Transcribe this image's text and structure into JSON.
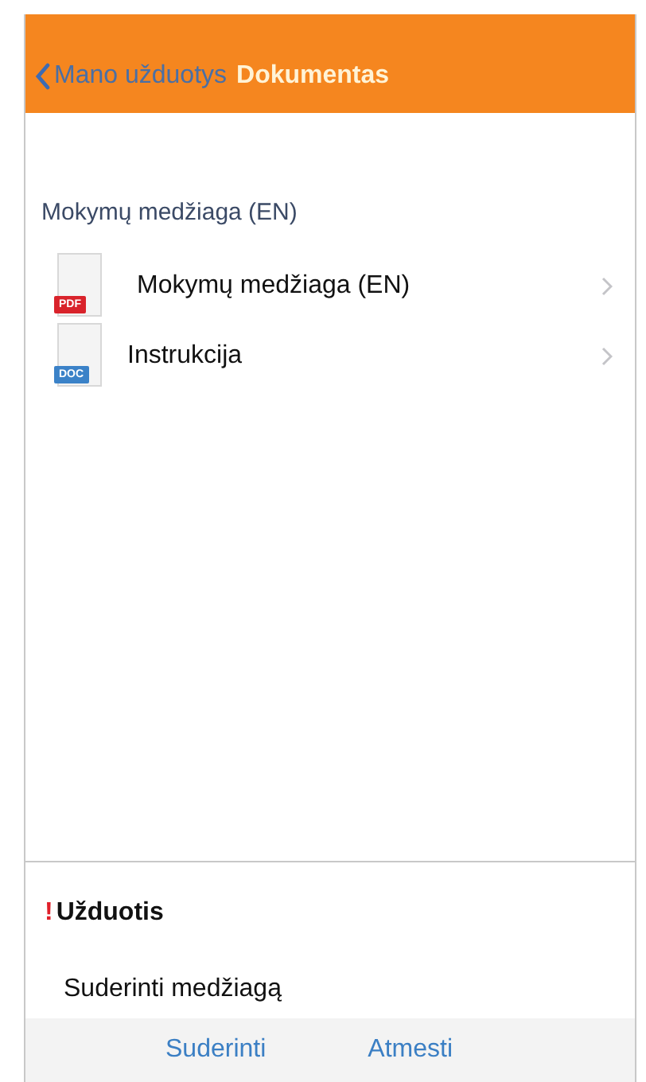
{
  "nav_bar": {
    "back_label": "Mano užduotys",
    "title": "Dokumentas"
  },
  "section": {
    "title": "Mokymų medžiaga (EN)",
    "documents": [
      {
        "kind": "pdf",
        "badge": "PDF",
        "name": "Mokymų medžiaga (EN)"
      },
      {
        "kind": "doc",
        "badge": "DOC",
        "name": "Instrukcija"
      }
    ]
  },
  "task": {
    "mark": "!",
    "title": "Užduotis",
    "description": "Suderinti medžiagą"
  },
  "actions": [
    "Suderinti",
    "Atmesti"
  ]
}
